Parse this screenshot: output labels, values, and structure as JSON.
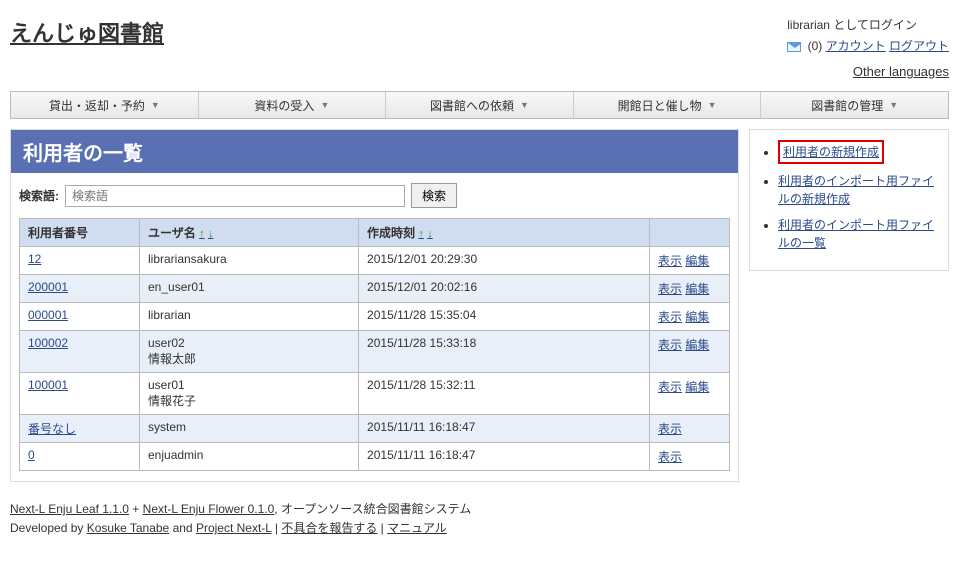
{
  "site_title": "えんじゅ図書館",
  "login": {
    "logged_as": "librarian としてログイン",
    "msg_count": "(0)",
    "account": "アカウント",
    "logout": "ログアウト"
  },
  "other_languages": "Other languages",
  "nav": [
    "貸出・返却・予約",
    "資料の受入",
    "図書館への依頼",
    "開館日と催し物",
    "図書館の管理"
  ],
  "page_title": "利用者の一覧",
  "search": {
    "label": "検索語:",
    "placeholder": "検索語",
    "button": "検索"
  },
  "columns": {
    "user_no": "利用者番号",
    "username": "ユーザ名",
    "created_at": "作成時刻",
    "actions": ""
  },
  "rows": [
    {
      "no": "12",
      "no_link": true,
      "uname": "librariansakura",
      "uname2": "",
      "created": "2015/12/01 20:29:30",
      "show": "表示",
      "edit": "編集"
    },
    {
      "no": "200001",
      "no_link": true,
      "uname": "en_user01",
      "uname2": "",
      "created": "2015/12/01 20:02:16",
      "show": "表示",
      "edit": "編集"
    },
    {
      "no": "000001",
      "no_link": true,
      "uname": "librarian",
      "uname2": "",
      "created": "2015/11/28 15:35:04",
      "show": "表示",
      "edit": "編集"
    },
    {
      "no": "100002",
      "no_link": true,
      "uname": "user02",
      "uname2": "情報太郎",
      "created": "2015/11/28 15:33:18",
      "show": "表示",
      "edit": "編集"
    },
    {
      "no": "100001",
      "no_link": true,
      "uname": "user01",
      "uname2": "情報花子",
      "created": "2015/11/28 15:32:11",
      "show": "表示",
      "edit": "編集"
    },
    {
      "no": "番号なし",
      "no_link": true,
      "uname": "system",
      "uname2": "",
      "created": "2015/11/11 16:18:47",
      "show": "表示",
      "edit": ""
    },
    {
      "no": "0",
      "no_link": true,
      "uname": "enjuadmin",
      "uname2": "",
      "created": "2015/11/11 16:18:47",
      "show": "表示",
      "edit": ""
    }
  ],
  "sidebar": [
    "利用者の新規作成",
    "利用者のインポート用ファイルの新規作成",
    "利用者のインポート用ファイルの一覧"
  ],
  "footer": {
    "enju_leaf": "Next-L Enju Leaf 1.1.0",
    "plus": " + ",
    "enju_flower": "Next-L Enju Flower 0.1.0",
    "desc": ", オープンソース統合図書館システム",
    "developed_by": "Developed by ",
    "kosuke": "Kosuke Tanabe",
    "and": " and ",
    "project": "Project Next-L",
    "sep": " | ",
    "bug": "不具合を報告する",
    "manual": "マニュアル"
  }
}
